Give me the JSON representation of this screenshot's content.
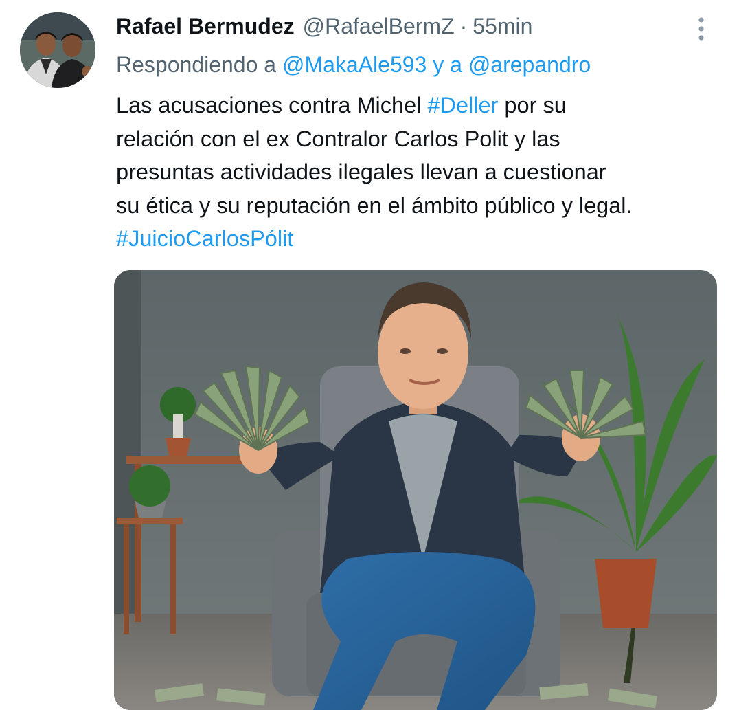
{
  "author": {
    "display_name": "Rafael Bermudez",
    "handle": "@RafaelBermZ",
    "separator": "·",
    "time": "55min"
  },
  "reply": {
    "prefix": "Respondiendo a",
    "user1": "@MakaAle593",
    "connector": "y a",
    "user2": "@arepandro"
  },
  "tweet": {
    "line1_pre": "Las acusaciones contra Michel ",
    "hashtag1": "#Deller",
    "line1_post": " por su",
    "line2": "relación con el ex Contralor Carlos Polit y las",
    "line3": "presuntas actividades ilegales llevan a cuestionar",
    "line4": "su ética y su reputación en el ámbito público y legal.",
    "hashtag2": "#JuicioCarlosPólit"
  },
  "icons": {
    "more": "more-vertical-icon"
  },
  "colors": {
    "text": "#0f1419",
    "secondary": "#536471",
    "link": "#1d9bf0"
  }
}
